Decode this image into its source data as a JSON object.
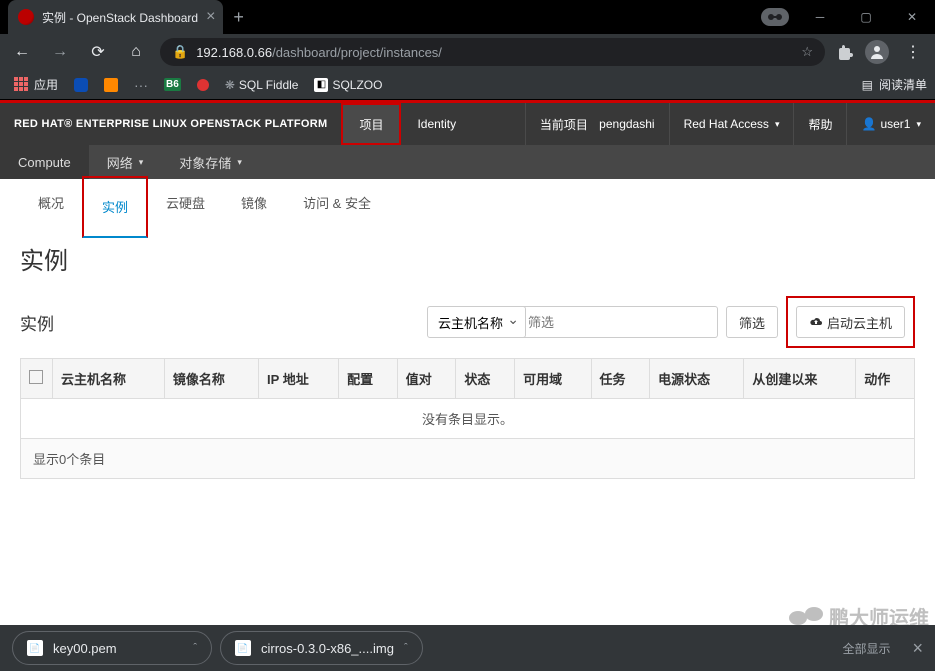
{
  "browser": {
    "tab_title": "实例 - OpenStack Dashboard",
    "url_host": "192.168.0.66",
    "url_path": "/dashboard/project/instances/",
    "bookmarks": {
      "apps": "应用",
      "sqlfiddle": "SQL Fiddle",
      "sqlzoo": "SQLZOO"
    },
    "reading_list": "阅读清单"
  },
  "header": {
    "brand": "RED HAT® ENTERPRISE LINUX OPENSTACK PLATFORM",
    "nav_project": "项目",
    "nav_identity": "Identity",
    "current_project_label": "当前项目",
    "current_project_value": "pengdashi",
    "rh_access": "Red Hat Access",
    "help": "帮助",
    "user": "user1"
  },
  "subnav": {
    "compute": "Compute",
    "network": "网络",
    "objstore": "对象存储"
  },
  "tabs": {
    "overview": "概况",
    "instances": "实例",
    "volumes": "云硬盘",
    "images": "镜像",
    "access": "访问 & 安全"
  },
  "page": {
    "title": "实例",
    "panel_title": "实例",
    "filter_select": "云主机名称",
    "filter_placeholder": "筛选",
    "filter_btn": "筛选",
    "launch_btn": "启动云主机",
    "columns": [
      "云主机名称",
      "镜像名称",
      "IP 地址",
      "配置",
      "值对",
      "状态",
      "可用域",
      "任务",
      "电源状态",
      "从创建以来",
      "动作"
    ],
    "empty": "没有条目显示。",
    "footer": "显示0个条目"
  },
  "downloads": {
    "file1": "key00.pem",
    "file2": "cirros-0.3.0-x86_....img",
    "showall": "全部显示"
  },
  "watermark": "鹏大师运维"
}
